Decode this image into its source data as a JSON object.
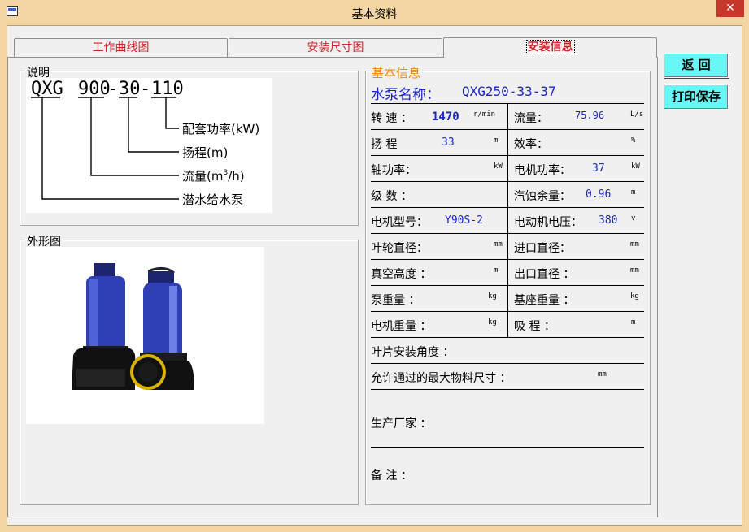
{
  "window": {
    "title": "基本资料",
    "close_symbol": "✕"
  },
  "tabs": [
    {
      "label": "工作曲线图"
    },
    {
      "label": "安装尺寸图"
    },
    {
      "label": "安装信息",
      "active": true
    }
  ],
  "description": {
    "group_label": "说明",
    "code_parts": [
      "QXG",
      "900",
      "30",
      "110"
    ],
    "legend": [
      "配套功率(kW)",
      "扬程(m)",
      "流量(m",
      "3",
      "/h)",
      "潜水给水泵"
    ]
  },
  "shape": {
    "group_label": "外形图"
  },
  "info": {
    "group_label": "基本信息",
    "pump_name_label": "水泵名称：",
    "pump_name_value": "QXG250-33-37",
    "rows": {
      "speed": {
        "label": "转 速 ：",
        "value": "1470",
        "unit": "r/min"
      },
      "flow": {
        "label": "流量：",
        "value": "75.96",
        "unit": "L/s"
      },
      "head": {
        "label": "扬 程",
        "value": "33",
        "unit": "m"
      },
      "efficiency": {
        "label": "效率：",
        "value": "",
        "unit": "%"
      },
      "shaft_power": {
        "label": "轴功率：",
        "value": "",
        "unit": "kW"
      },
      "motor_power": {
        "label": "电机功率：",
        "value": "37",
        "unit": "kW"
      },
      "stages": {
        "label": "级 数 ：",
        "value": ""
      },
      "npsh": {
        "label": "汽蚀余量：",
        "value": "0.96",
        "unit": "m"
      },
      "motor_model": {
        "label": "电机型号：",
        "value": "Y90S-2"
      },
      "motor_voltage": {
        "label": "电动机电压：",
        "value": "380",
        "unit": "v"
      },
      "impeller_dia": {
        "label": "叶轮直径：",
        "unit": "mm"
      },
      "inlet_dia": {
        "label": "进口直径：",
        "unit": "mm"
      },
      "vacuum_height": {
        "label": "真空高度 ：",
        "unit": "m"
      },
      "outlet_dia": {
        "label": "出口直径 ：",
        "unit": "mm"
      },
      "pump_weight": {
        "label": "泵重量 ：",
        "unit": "kg"
      },
      "base_weight": {
        "label": "基座重量 ：",
        "unit": "kg"
      },
      "motor_weight": {
        "label": "电机重量 ：",
        "unit": "kg"
      },
      "suction_head": {
        "label": "吸 程 ：",
        "unit": "m"
      },
      "blade_angle": {
        "label": "叶片安装角度 ："
      },
      "max_particle": {
        "label": "允许通过的最大物料尺寸 ：",
        "unit": "mm"
      },
      "manufacturer": {
        "label": "生产厂家 ："
      },
      "remarks": {
        "label": "备 注 ："
      }
    }
  },
  "buttons": {
    "back": "返 回",
    "print_save": "打印保存"
  },
  "colors": {
    "window_frame": "#f3d6a3",
    "tab_text": "#d0242c",
    "info_label": "#f08a00",
    "value_blue": "#1a23c8",
    "button_cyan": "#66f7f6",
    "pump_blue": "#2e3fb5"
  }
}
